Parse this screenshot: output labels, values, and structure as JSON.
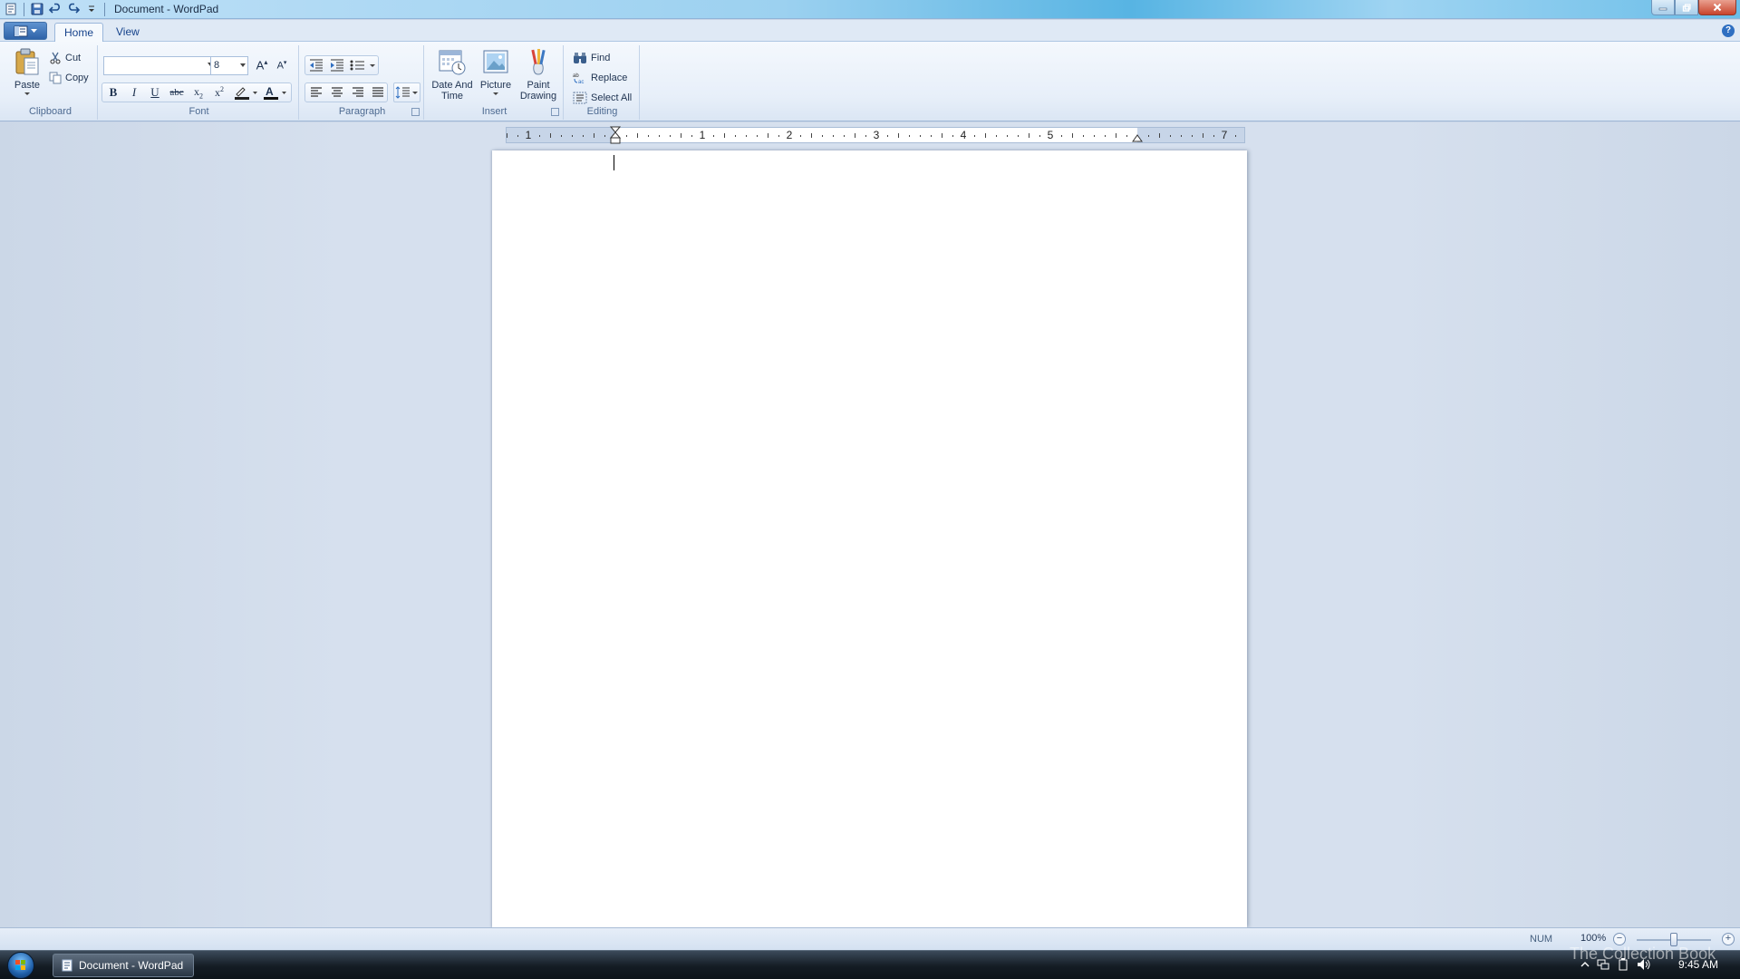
{
  "window": {
    "title": "Document - WordPad"
  },
  "tabs": [
    {
      "label": "Home",
      "active": true
    },
    {
      "label": "View",
      "active": false
    }
  ],
  "clipboard": {
    "group_label": "Clipboard",
    "paste": "Paste",
    "cut": "Cut",
    "copy": "Copy"
  },
  "font": {
    "group_label": "Font",
    "family_value": "",
    "size_value": "8"
  },
  "paragraph": {
    "group_label": "Paragraph"
  },
  "insert": {
    "group_label": "Insert",
    "date_time_line1": "Date And",
    "date_time_line2": "Time",
    "picture": "Picture",
    "paint_line1": "Paint",
    "paint_line2": "Drawing"
  },
  "editing": {
    "group_label": "Editing",
    "find": "Find",
    "replace": "Replace",
    "select_all": "Select All"
  },
  "ruler": {
    "labels": [
      "1",
      "1",
      "2",
      "3",
      "4",
      "5",
      "7"
    ]
  },
  "status": {
    "num": "NUM",
    "zoom": "100%"
  },
  "taskbar": {
    "item": "Document - WordPad",
    "clock": "9:45 AM"
  },
  "watermark": "The Collection Book"
}
